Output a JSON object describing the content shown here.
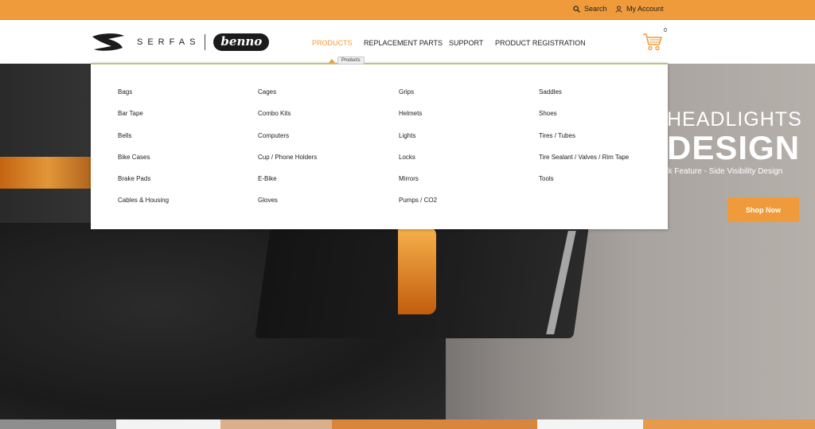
{
  "topbar": {
    "search_label": "Search",
    "account_label": "My Account"
  },
  "header": {
    "logo_serfas": "SERFAS",
    "logo_benno": "benno",
    "nav": {
      "products": "PRODUCTS",
      "replacement": "REPLACEMENT PARTS",
      "support": "SUPPORT",
      "registration": "PRODUCT REGISTRATION"
    },
    "cart_count": "0",
    "tooltip": "Products"
  },
  "hero": {
    "heading1": "HEADLIGHTS",
    "heading2": "DESIGN",
    "subtitle": "ock Feature - Side Visibility Design",
    "shop_label": "Shop Now"
  },
  "mega_menu": {
    "col1": [
      "Bags",
      "Bar Tape",
      "Bells",
      "Bike Cases",
      "Brake Pads",
      "Cables & Housing"
    ],
    "col2": [
      "Cages",
      "Combo Kits",
      "Computers",
      "Cup / Phone Holders",
      "E-Bike",
      "Gloves"
    ],
    "col3": [
      "Grips",
      "Helmets",
      "Lights",
      "Locks",
      "Mirrors",
      "Pumps / CO2"
    ],
    "col4": [
      "Saddles",
      "Shoes",
      "Tires / Tubes",
      "Tire Sealant / Valves / Rim Tape",
      "Tools"
    ]
  },
  "colors": {
    "accent": "#ef9b3c",
    "menu_border": "#b7c77e"
  }
}
